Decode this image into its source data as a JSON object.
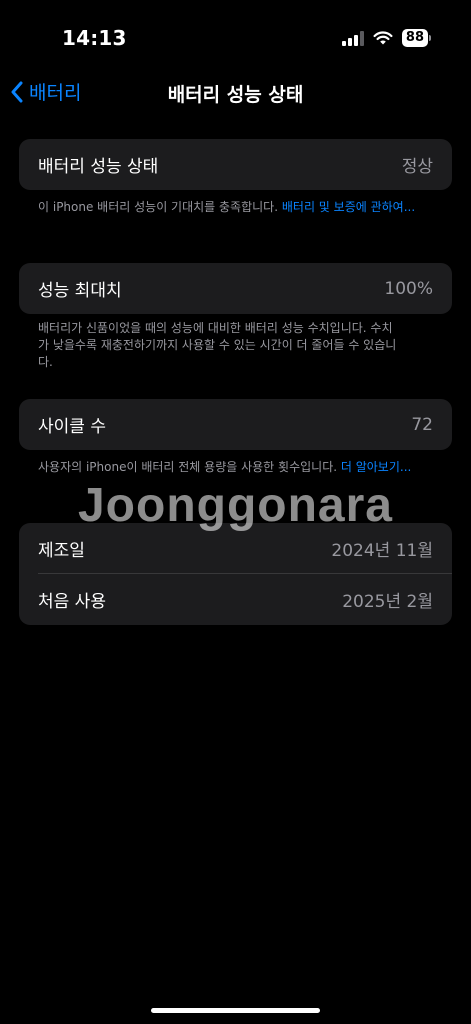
{
  "status_bar": {
    "time": "14:13",
    "battery_level": "88",
    "signal_bars_active": 3,
    "signal_bars_total": 4
  },
  "nav": {
    "back_label": "배터리",
    "title": "배터리 성능 상태",
    "accent_color": "#0a84ff"
  },
  "health": {
    "label": "배터리 성능 상태",
    "value": "정상",
    "footnote": "이 iPhone 배터리 성능이 기대치를 충족합니다. ",
    "link": "배터리 및 보증에 관하여..."
  },
  "max_capacity": {
    "label": "성능 최대치",
    "value": "100%",
    "footnote": "배터리가 신품이었을 때의 성능에 대비한 배터리 성능 수치입니다. 수치가 낮을수록 재충전하기까지 사용할 수 있는 시간이 더 줄어들 수 있습니다."
  },
  "cycle_count": {
    "label": "사이클 수",
    "value": "72",
    "footnote": "사용자의 iPhone이 배터리 전체 용량을 사용한 횟수입니다. ",
    "link": "더 알아보기..."
  },
  "dates": {
    "manufactured_label": "제조일",
    "manufactured_value": "2024년 11월",
    "first_use_label": "처음 사용",
    "first_use_value": "2025년 2월"
  },
  "watermark": "Joonggonara"
}
